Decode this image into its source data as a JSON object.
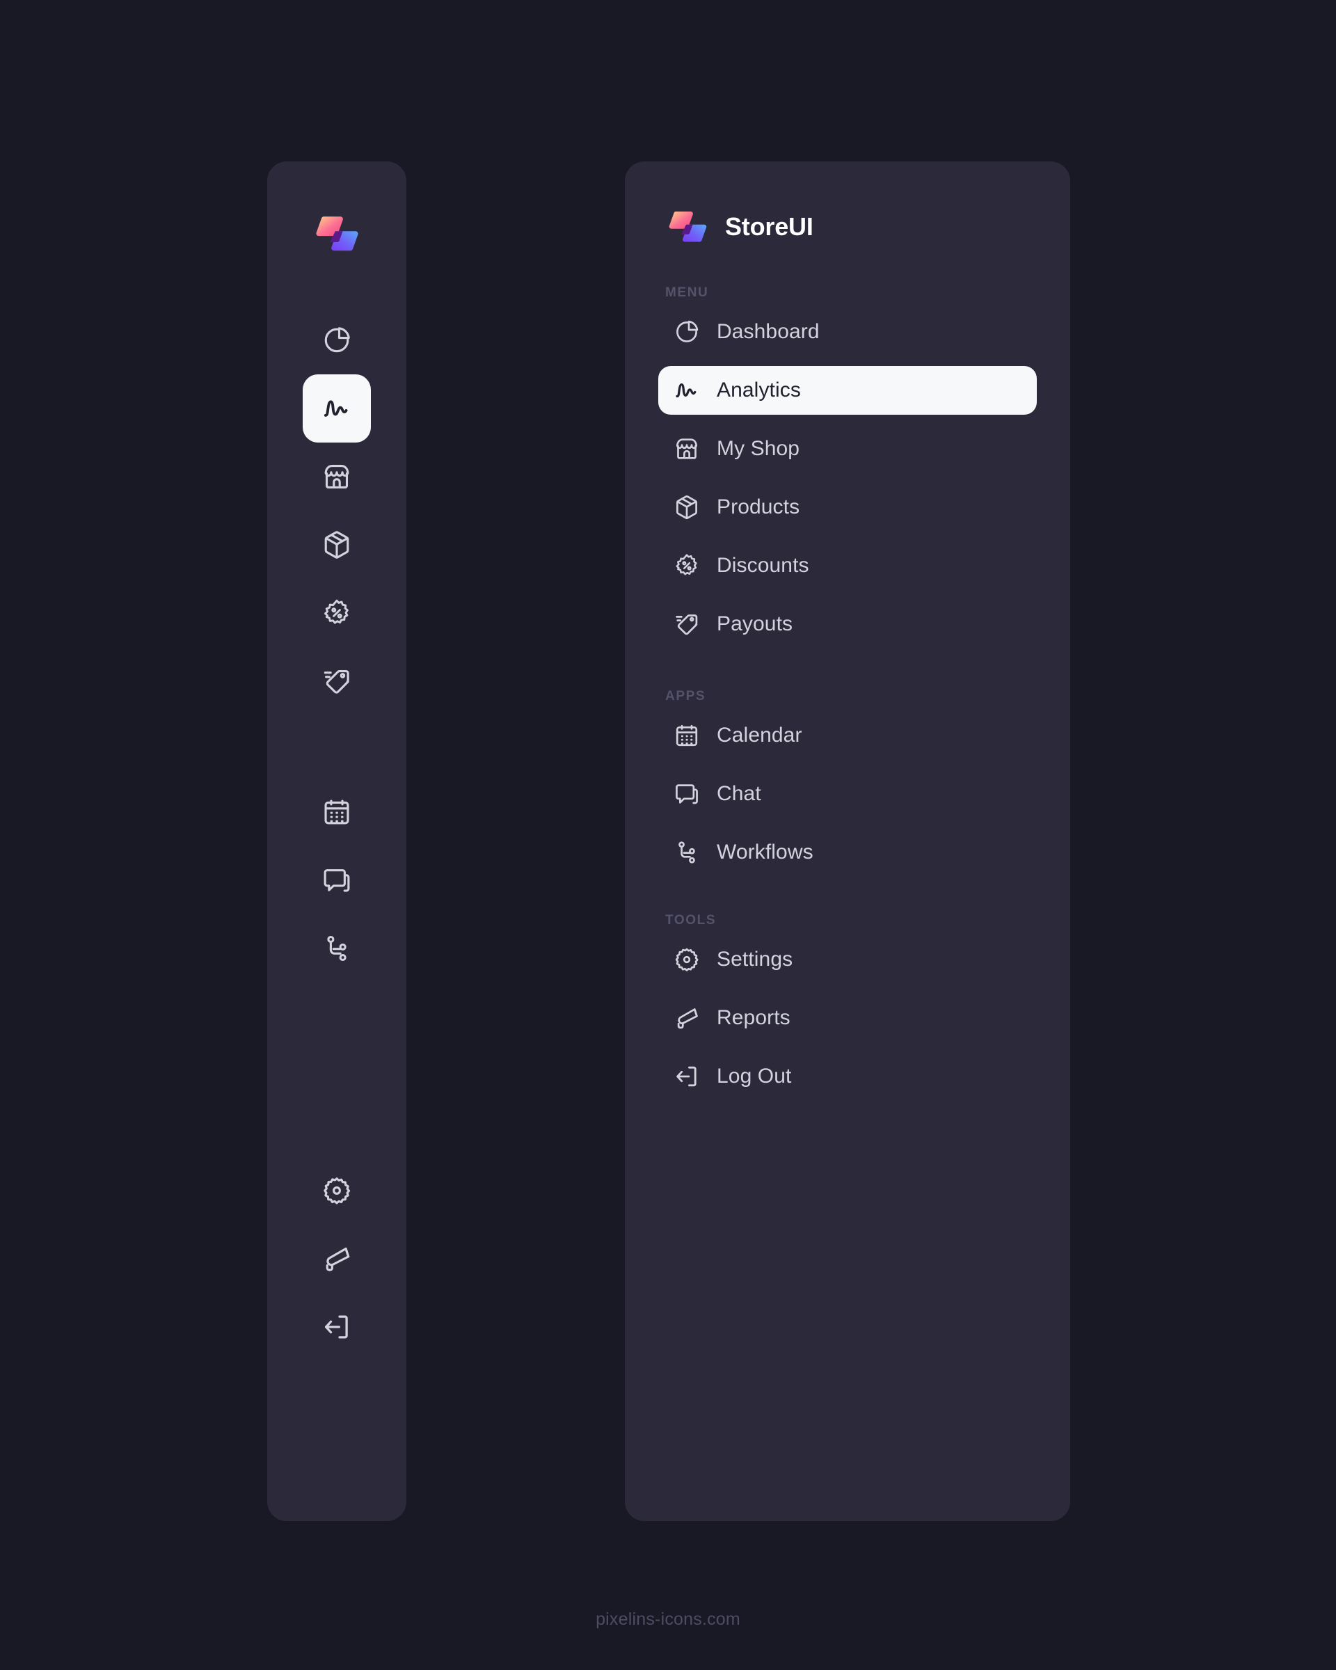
{
  "app": {
    "name": "StoreUI",
    "logo_icon": "storeui-logo-mark",
    "colors": {
      "page_background": "#191926",
      "panel_background": "#2c2a3a",
      "active_background": "#f7f8fa",
      "active_text": "#23212f",
      "item_text": "#d3d3de",
      "section_label": "#55536a",
      "footer_text": "#4e4c63",
      "logo_gradient_warm_start": "#ffd48a",
      "logo_gradient_warm_end": "#f8487f",
      "logo_gradient_cool_start": "#5aa9fb",
      "logo_gradient_cool_end": "#7b3df5",
      "logo_overlap": "#5b1a8c"
    }
  },
  "rail": {
    "logo_icon": "storeui-logo-mark",
    "groups": [
      {
        "name": "menu",
        "items": [
          {
            "icon": "pie-chart-icon",
            "name": "dashboard",
            "active": false
          },
          {
            "icon": "activity-wave-icon",
            "name": "analytics",
            "active": true
          },
          {
            "icon": "storefront-icon",
            "name": "my-shop",
            "active": false
          },
          {
            "icon": "package-box-icon",
            "name": "products",
            "active": false
          },
          {
            "icon": "discount-badge-icon",
            "name": "discounts",
            "active": false
          },
          {
            "icon": "price-tag-icon",
            "name": "payouts",
            "active": false
          }
        ]
      },
      {
        "name": "apps",
        "items": [
          {
            "icon": "calendar-icon",
            "name": "calendar",
            "active": false
          },
          {
            "icon": "chat-bubbles-icon",
            "name": "chat",
            "active": false
          },
          {
            "icon": "workflow-branch-icon",
            "name": "workflows",
            "active": false
          }
        ]
      },
      {
        "name": "tools",
        "items": [
          {
            "icon": "gear-icon",
            "name": "settings",
            "active": false
          },
          {
            "icon": "megaphone-icon",
            "name": "reports",
            "active": false
          },
          {
            "icon": "logout-arrow-icon",
            "name": "log-out",
            "active": false
          }
        ]
      }
    ]
  },
  "panel": {
    "sections": [
      {
        "label": "MENU",
        "items": [
          {
            "label": "Dashboard",
            "icon": "pie-chart-icon",
            "active": false
          },
          {
            "label": "Analytics",
            "icon": "activity-wave-icon",
            "active": true
          },
          {
            "label": "My Shop",
            "icon": "storefront-icon",
            "active": false
          },
          {
            "label": "Products",
            "icon": "package-box-icon",
            "active": false
          },
          {
            "label": "Discounts",
            "icon": "discount-badge-icon",
            "active": false
          },
          {
            "label": "Payouts",
            "icon": "price-tag-icon",
            "active": false
          }
        ]
      },
      {
        "label": "APPS",
        "items": [
          {
            "label": "Calendar",
            "icon": "calendar-icon",
            "active": false
          },
          {
            "label": "Chat",
            "icon": "chat-bubbles-icon",
            "active": false
          },
          {
            "label": "Workflows",
            "icon": "workflow-branch-icon",
            "active": false
          }
        ]
      },
      {
        "label": "TOOLS",
        "items": [
          {
            "label": "Settings",
            "icon": "gear-icon",
            "active": false
          },
          {
            "label": "Reports",
            "icon": "megaphone-icon",
            "active": false
          },
          {
            "label": "Log Out",
            "icon": "logout-arrow-icon",
            "active": false
          }
        ]
      }
    ]
  },
  "footer": {
    "text": "pixelins-icons.com"
  }
}
